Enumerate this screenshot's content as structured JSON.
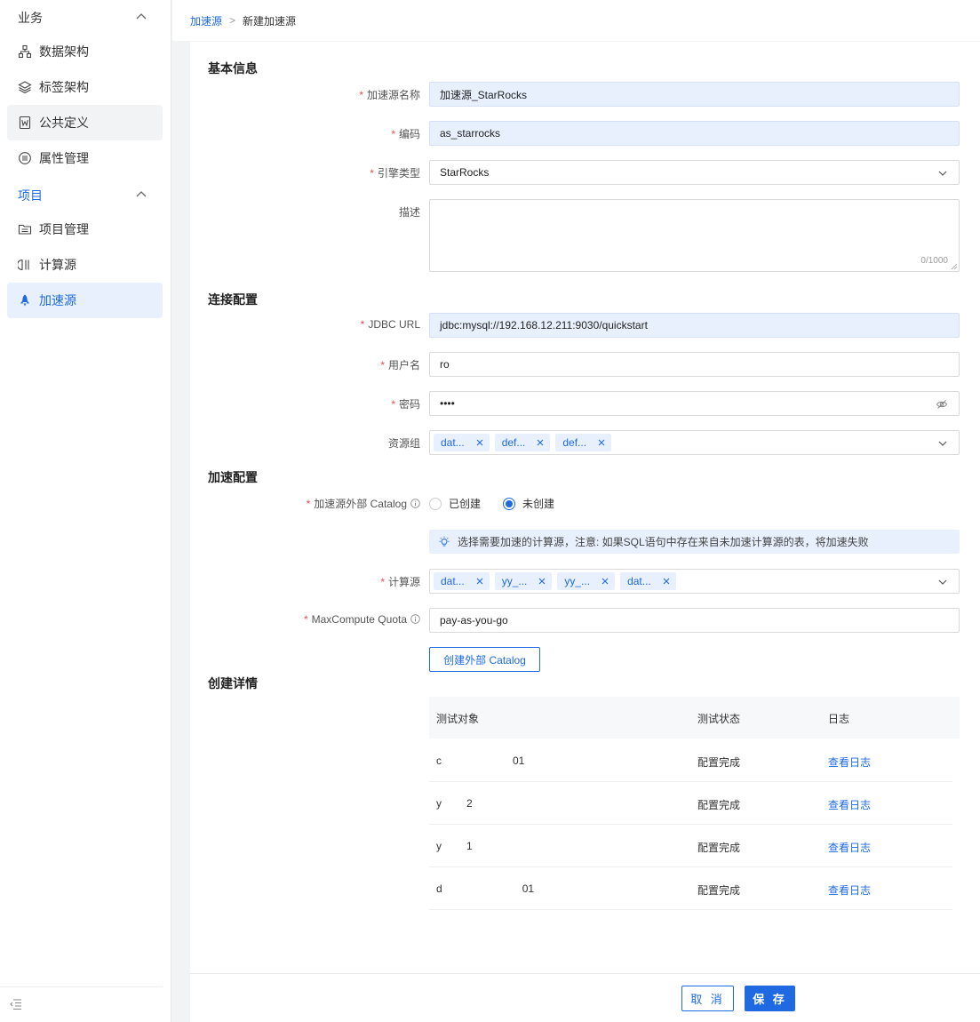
{
  "sidebar": {
    "group_business": "业务",
    "group_project": "项目",
    "items": [
      {
        "label": "数据架构",
        "icon": "data-architecture-icon"
      },
      {
        "label": "标签架构",
        "icon": "layers-icon"
      },
      {
        "label": "公共定义",
        "icon": "word-doc-icon"
      },
      {
        "label": "属性管理",
        "icon": "attribute-icon"
      },
      {
        "label": "项目管理",
        "icon": "folder-icon"
      },
      {
        "label": "计算源",
        "icon": "compute-source-icon"
      },
      {
        "label": "加速源",
        "icon": "rocket-icon"
      }
    ],
    "active_item": "加速源",
    "active_color": "#1f6ae0"
  },
  "breadcrumb": {
    "parent": "加速源",
    "separator": ">",
    "current": "新建加速源"
  },
  "sections": {
    "basic": "基本信息",
    "connection": "连接配置",
    "acceleration": "加速配置",
    "details": "创建详情"
  },
  "form": {
    "name_label": "加速源名称",
    "name_value": "加速源_StarRocks",
    "code_label": "编码",
    "code_value": "as_starrocks",
    "engine_label": "引擎类型",
    "engine_value": "StarRocks",
    "desc_label": "描述",
    "desc_counter": "0/1000",
    "jdbc_label": "JDBC URL",
    "jdbc_value": "jdbc:mysql://192.168.12.211:9030/quickstart",
    "user_label": "用户名",
    "user_value": "ro",
    "password_label": "密码",
    "password_value": "••••",
    "resource_label": "资源组",
    "resource_tags": [
      "dat...",
      "def...",
      "def..."
    ],
    "catalog_label": "加速源外部 Catalog",
    "catalog_options": [
      "已创建",
      "未创建"
    ],
    "catalog_selected": "未创建",
    "tip_text": "选择需要加速的计算源，注意: 如果SQL语句中存在来自未加速计算源的表，将加速失败",
    "compute_label": "计算源",
    "compute_tags": [
      "dat...",
      "yy_...",
      "yy_...",
      "dat..."
    ],
    "quota_label": "MaxCompute Quota",
    "quota_value": "pay-as-you-go",
    "create_catalog_button": "创建外部 Catalog"
  },
  "table": {
    "columns": [
      "测试对象",
      "测试状态",
      "日志"
    ],
    "rows": [
      {
        "object_start": "c",
        "object_end": "01",
        "status": "配置完成",
        "log": "查看日志"
      },
      {
        "object_start": "y",
        "object_end": "2",
        "status": "配置完成",
        "log": "查看日志"
      },
      {
        "object_start": "y",
        "object_end": "1",
        "status": "配置完成",
        "log": "查看日志"
      },
      {
        "object_start": "d",
        "object_end": "01",
        "status": "配置完成",
        "log": "查看日志"
      }
    ]
  },
  "footer": {
    "cancel": "取 消",
    "save": "保 存"
  }
}
